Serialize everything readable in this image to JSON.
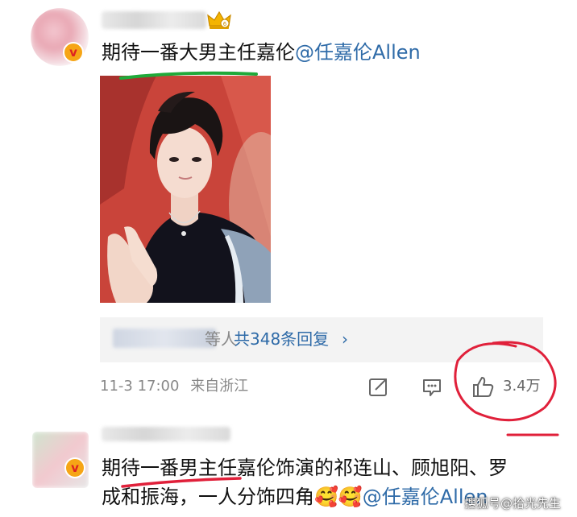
{
  "comment1": {
    "text_plain": "期待一番大男主任嘉伦",
    "mention": "@任嘉伦Allen",
    "verified_icon": "v-badge-icon",
    "badge_icon": "crown-fan-badge-icon",
    "replies_tail": "等人",
    "replies_link": "共348条回复",
    "replies_chevron": "›",
    "timestamp": "11-3 17:00",
    "location": "来自浙江",
    "like_count": "3.4万"
  },
  "comment2": {
    "line1": "期待一番男主任嘉伦饰演的祁连山、顾旭阳、罗",
    "line2_plain": "成和振海，一人分饰四角",
    "line2_emoji": "🥰🥰",
    "line2_mention": "@任嘉伦Allen"
  },
  "watermark": "搜狐号@拾光先生",
  "colors": {
    "mention_blue": "#2f6ba8",
    "annotation_green": "#1faa3a",
    "annotation_red": "#e0203a",
    "badge_orange": "#f6a516"
  }
}
